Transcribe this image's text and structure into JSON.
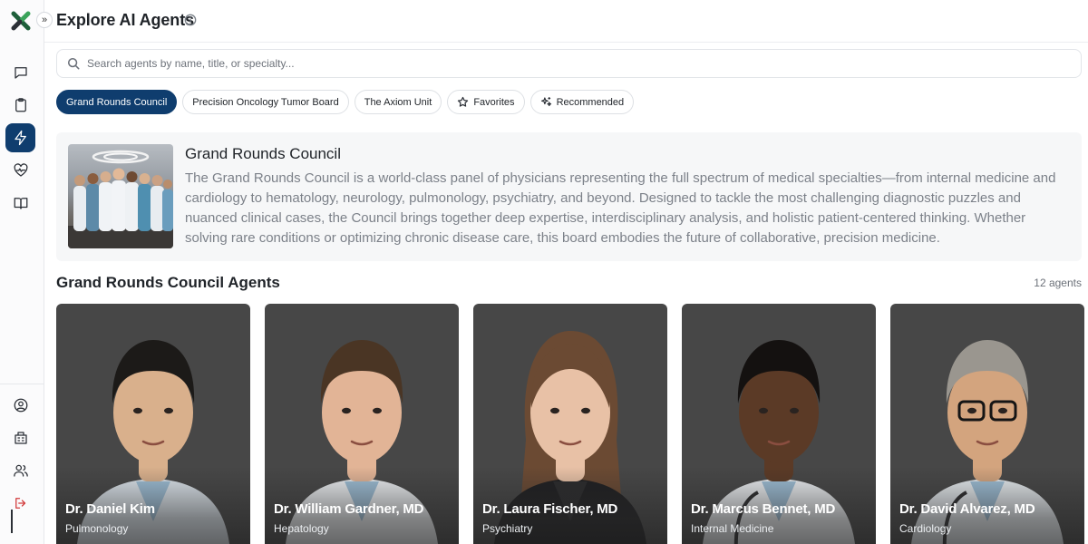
{
  "header": {
    "title": "Explore AI Agents",
    "collapse_glyph": "»"
  },
  "search": {
    "placeholder": "Search agents by name, title, or specialty...",
    "value": ""
  },
  "sidebar": {
    "top_items": [
      {
        "icon": "chat-bubble-icon"
      },
      {
        "icon": "clipboard-icon"
      },
      {
        "icon": "lightning-icon",
        "active": true
      },
      {
        "icon": "heart-pulse-icon"
      },
      {
        "icon": "book-open-icon"
      }
    ],
    "bottom_items": [
      {
        "icon": "user-circle-icon"
      },
      {
        "icon": "building-icon"
      },
      {
        "icon": "users-icon"
      },
      {
        "icon": "logout-icon"
      }
    ]
  },
  "filters": [
    {
      "label": "Grand Rounds Council",
      "active": true
    },
    {
      "label": "Precision Oncology Tumor Board"
    },
    {
      "label": "The Axiom Unit"
    },
    {
      "label": "Favorites",
      "icon": "star-icon"
    },
    {
      "label": "Recommended",
      "icon": "sparkles-icon"
    }
  ],
  "council": {
    "title": "Grand Rounds Council",
    "description": "The Grand Rounds Council is a world-class panel of physicians representing the full spectrum of medical specialties—from internal medicine and cardiology to hematology, neurology, pulmonology, psychiatry, and beyond. Designed to tackle the most challenging diagnostic puzzles and nuanced clinical cases, the Council brings together deep expertise, interdisciplinary analysis, and holistic patient-centered thinking. Whether solving rare conditions or optimizing chronic disease care, this board embodies the future of collaborative, precision medicine."
  },
  "agents_section": {
    "title": "Grand Rounds Council Agents",
    "count": "12 agents"
  },
  "agents": [
    {
      "name": "Dr. Daniel Kim",
      "specialty": "Pulmonology",
      "skin": "#d9b08c",
      "hair": "#1c1a18",
      "coat": "#dfe7ee"
    },
    {
      "name": "Dr. William Gardner, MD",
      "specialty": "Hepatology",
      "skin": "#e2b496",
      "hair": "#4a3524",
      "coat": "#eef1f4"
    },
    {
      "name": "Dr. Laura Fischer, MD",
      "specialty": "Psychiatry",
      "skin": "#e8c1a6",
      "hair": "#6b4a33",
      "coat": "#1e1e20"
    },
    {
      "name": "Dr. Marcus Bennet, MD",
      "specialty": "Internal Medicine",
      "skin": "#5b3a26",
      "hair": "#141110",
      "coat": "#eef1f4"
    },
    {
      "name": "Dr. David Alvarez, MD",
      "specialty": "Cardiology",
      "skin": "#d3a47e",
      "hair": "#9a968f",
      "coat": "#e9eef2"
    }
  ]
}
